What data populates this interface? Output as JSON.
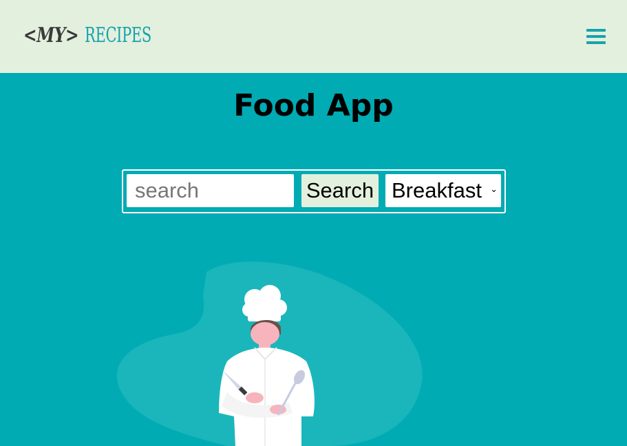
{
  "navbar": {
    "logo_prefix": "<MY>",
    "logo_suffix": "RECIPES",
    "menu_icon": "hamburger-menu-icon"
  },
  "main": {
    "title": "Food App",
    "search": {
      "placeholder": "search",
      "value": "",
      "button_label": "Search",
      "category_selected": "Breakfast"
    },
    "illustration": "chef-illustration"
  },
  "colors": {
    "background": "#00abb3",
    "navbar": "#e3f0dd",
    "accent": "#17a2ad",
    "blob": "#1ab6bb"
  }
}
